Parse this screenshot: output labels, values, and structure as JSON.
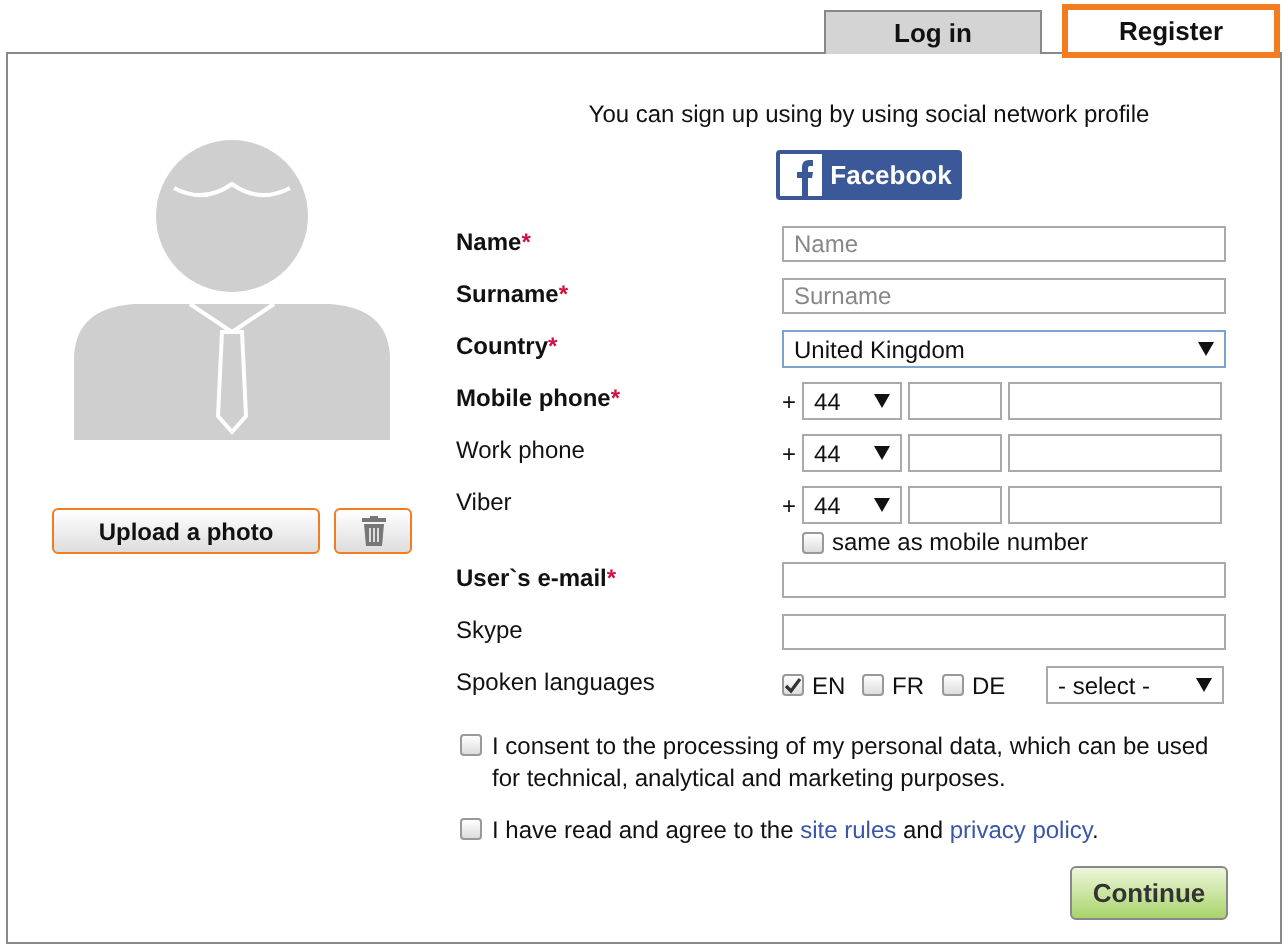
{
  "tabs": [
    {
      "label": "Log in",
      "selected": false
    },
    {
      "label": "Register",
      "selected": true
    }
  ],
  "social": {
    "prompt": "You can sign up using by using social network profile",
    "button": "Facebook"
  },
  "photo": {
    "upload_button": "Upload a photo"
  },
  "form": {
    "rows": [
      {
        "kind": "text",
        "label": "Name",
        "required": true,
        "mark": "*",
        "placeholder": "Name"
      },
      {
        "kind": "text",
        "label": "Surname",
        "required": true,
        "mark": "*",
        "placeholder": "Surname"
      },
      {
        "kind": "select",
        "label": "Country",
        "required": true,
        "mark": "*",
        "value": "United Kingdom"
      },
      {
        "kind": "phone",
        "label": "Mobile phone",
        "required": true,
        "mark": "*",
        "plus": "+",
        "code": "44"
      },
      {
        "kind": "phone",
        "label": "Work phone",
        "required": false,
        "plus": "+",
        "code": "44"
      },
      {
        "kind": "phone",
        "label": "Viber",
        "required": false,
        "plus": "+",
        "code": "44",
        "same_as": {
          "label": "same as mobile number",
          "checked": false
        }
      },
      {
        "kind": "text",
        "label": "User`s e-mail",
        "required": true,
        "mark": "*"
      },
      {
        "kind": "text",
        "label": "Skype",
        "required": false
      },
      {
        "kind": "languages",
        "label": "Spoken languages",
        "required": false,
        "options": [
          {
            "label": "EN",
            "checked": true
          },
          {
            "label": "FR",
            "checked": false
          },
          {
            "label": "DE",
            "checked": false
          }
        ],
        "select": "- select -"
      }
    ]
  },
  "agreements": [
    {
      "checked": false,
      "segments": [
        {
          "kind": "text",
          "text": "I consent to the processing of my personal data, which can be used for technical, analytical and marketing purposes."
        }
      ]
    },
    {
      "checked": false,
      "segments": [
        {
          "kind": "text",
          "text": "I have read and agree to the "
        },
        {
          "kind": "link",
          "text": "site rules"
        },
        {
          "kind": "text",
          "text": " and "
        },
        {
          "kind": "link",
          "text": "privacy policy"
        },
        {
          "kind": "text",
          "text": "."
        }
      ]
    }
  ],
  "continue_button": "Continue"
}
